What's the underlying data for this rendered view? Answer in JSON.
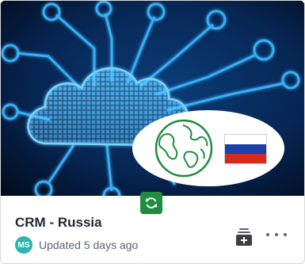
{
  "card": {
    "title": "CRM - Russia",
    "avatar_initials": "MS",
    "updated_text": "Updated 5 days ago"
  },
  "thumbnail": {
    "subject": "cloud-network-illustration",
    "globe_icon": "globe-icon",
    "flag_icon": "russia-flag-icon"
  },
  "badge": {
    "icon": "sync-icon",
    "color": "#1f8c3f"
  },
  "actions": {
    "add_icon": "add-to-collection-icon",
    "more_icon": "more-options-icon"
  },
  "colors": {
    "title": "#1f2933",
    "secondary_text": "#5c6670",
    "avatar": "#2bb6b0",
    "thumbnail_background": "#041833",
    "network_glow": "#3ab6ff"
  }
}
